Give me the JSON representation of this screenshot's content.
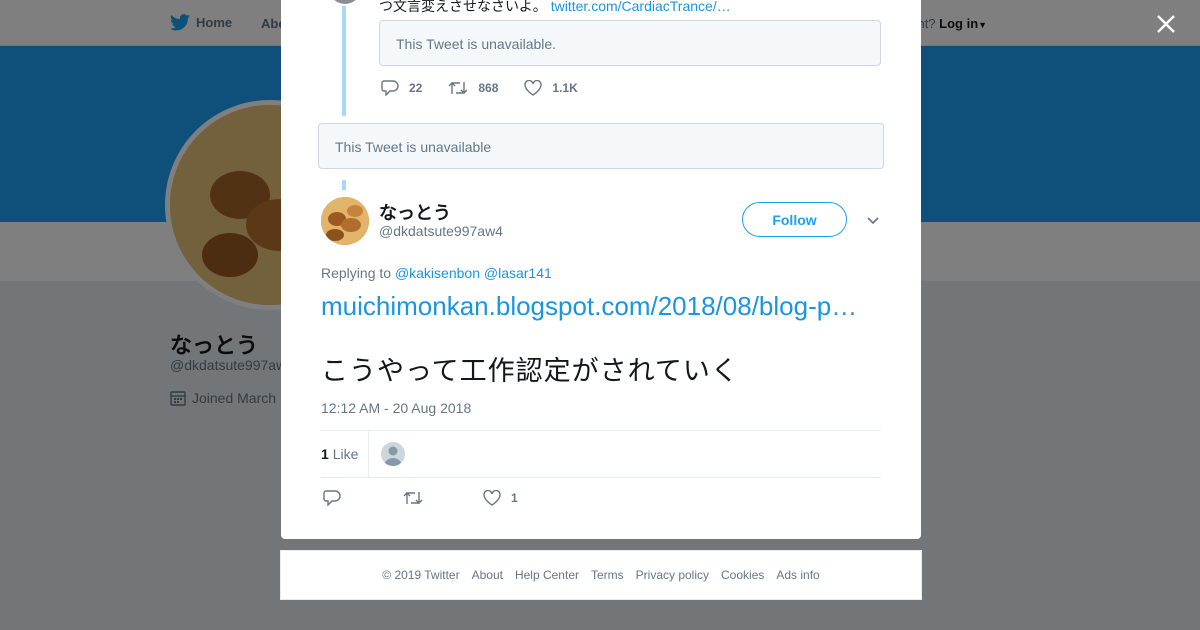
{
  "nav": {
    "home": "Home",
    "about": "Abo",
    "login_prompt": "ccount?",
    "login": "Log in"
  },
  "profile": {
    "name": "なっとう",
    "handle": "@dkdatsute997aw",
    "joined": "Joined March"
  },
  "previous_tweet": {
    "text": "つ文言変えさせなさいよ。",
    "link": "twitter.com/CardiacTrance/…",
    "quote": "This Tweet is unavailable.",
    "replies": "22",
    "retweets": "868",
    "likes": "1.1K"
  },
  "unavailable": "This Tweet is unavailable",
  "tweet": {
    "author_name": "なっとう",
    "author_handle": "@dkdatsute997aw4",
    "follow_label": "Follow",
    "replying_prefix": "Replying to",
    "mention_1": "@kakisenbon",
    "mention_2": "@lasar141",
    "link_text": "muichimonkan.blogspot.com/2018/08/blog-p…",
    "body": "こうやって工作認定がされていく",
    "timestamp": "12:12 AM - 20 Aug 2018",
    "like_count": "1",
    "like_label": "Like",
    "action_like_count": "1"
  },
  "footer": {
    "copyright": "© 2019 Twitter",
    "about": "About",
    "help": "Help Center",
    "terms": "Terms",
    "privacy": "Privacy policy",
    "cookies": "Cookies",
    "ads": "Ads info"
  },
  "colors": {
    "accent": "#1da1f2",
    "link": "#1b95e0",
    "muted": "#657786"
  }
}
